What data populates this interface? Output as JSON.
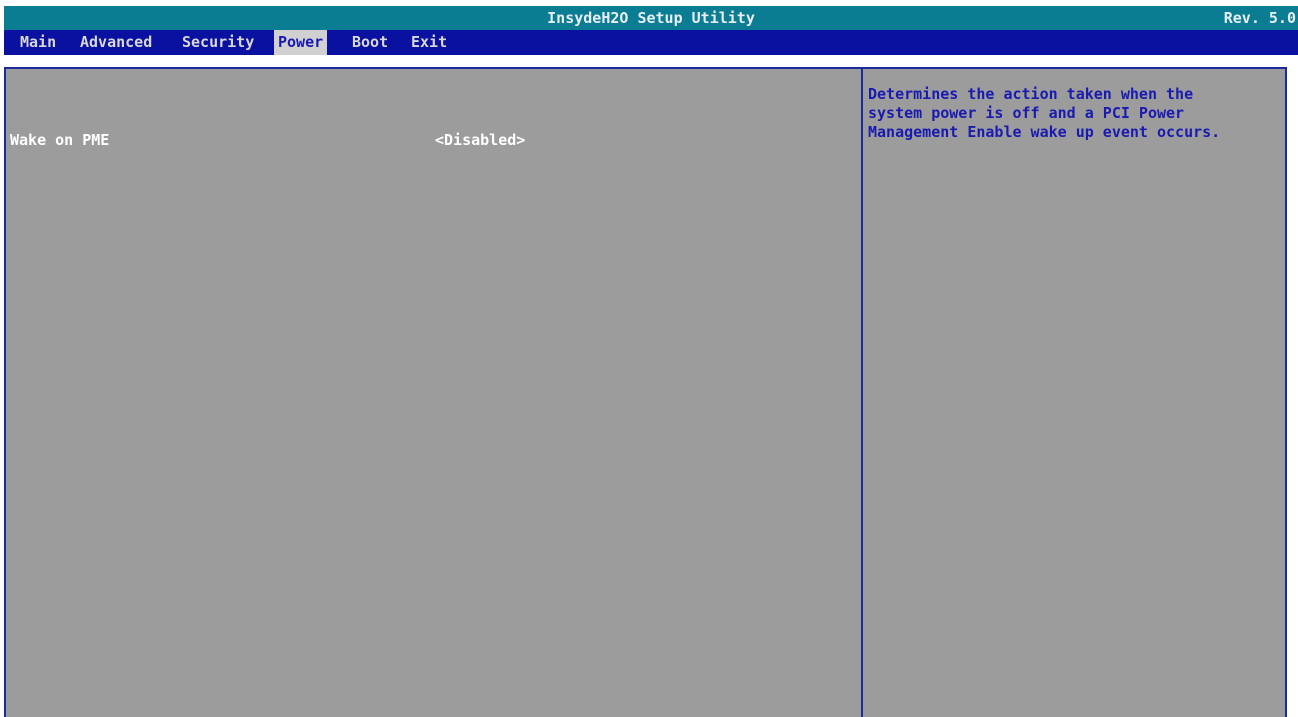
{
  "header": {
    "title": "InsydeH2O Setup Utility",
    "revision": "Rev. 5.0"
  },
  "menu": {
    "items": [
      {
        "label": "Main",
        "active": false
      },
      {
        "label": "Advanced",
        "active": false
      },
      {
        "label": "Security",
        "active": false
      },
      {
        "label": "Power",
        "active": true
      },
      {
        "label": "Boot",
        "active": false
      },
      {
        "label": "Exit",
        "active": false
      }
    ]
  },
  "settings": [
    {
      "label": "Wake on PME",
      "value": "<Disabled>"
    }
  ],
  "help": {
    "lines": [
      "Determines the action taken when the",
      "system power is off and a PCI Power",
      "Management Enable wake up event occurs."
    ]
  },
  "colors": {
    "title_bar": "#0a7d93",
    "menu_bar": "#0a10a0",
    "active_menu_bg": "#d0d0d0",
    "content_bg": "#9c9c9c",
    "border": "#1e2a9a",
    "help_text": "#1a1ab0"
  }
}
